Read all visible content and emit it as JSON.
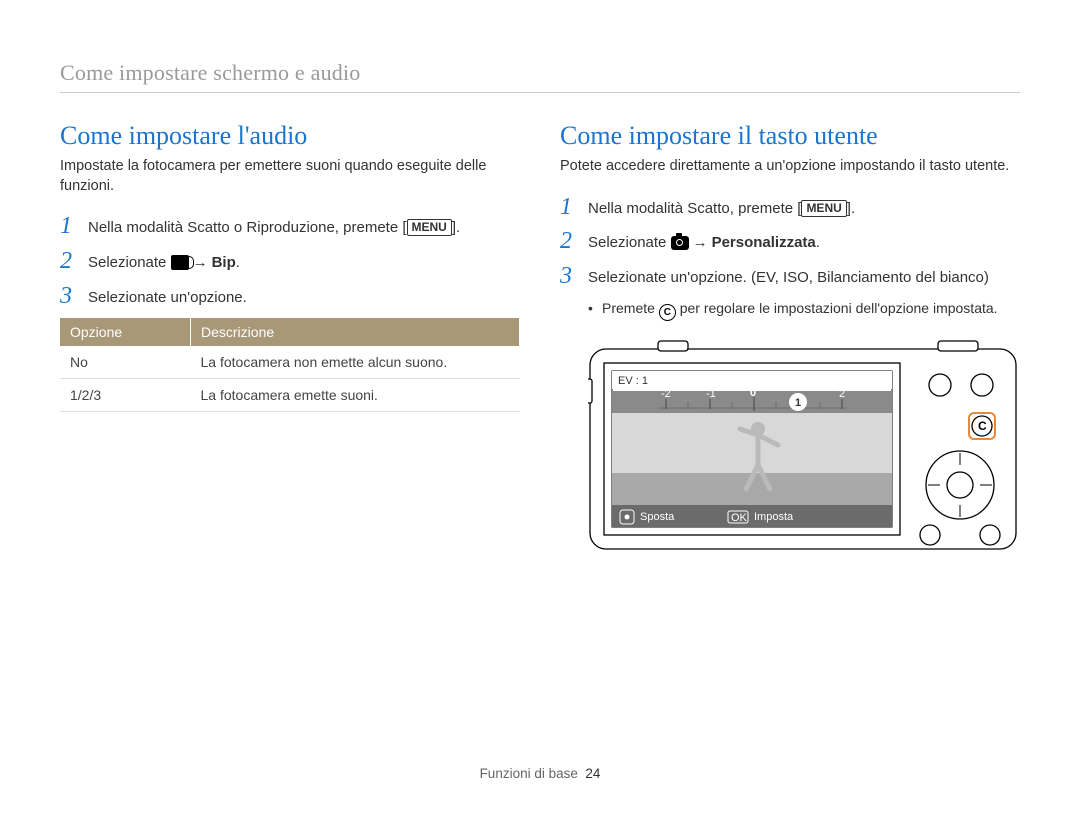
{
  "header": {
    "running_title": "Come impostare schermo e audio"
  },
  "left": {
    "heading": "Come impostare l'audio",
    "intro": "Impostate la fotocamera per emettere suoni quando eseguite delle funzioni.",
    "steps": [
      {
        "n": "1",
        "pre": "Nella modalità Scatto o Riproduzione, premete [",
        "menu": "MENU",
        "post": "]."
      },
      {
        "n": "2",
        "pre": "Selezionate ",
        "icon": "sound",
        "arrow": "→",
        "bold": "Bip",
        "post": "."
      },
      {
        "n": "3",
        "pre": "Selezionate un'opzione."
      }
    ],
    "table": {
      "headers": [
        "Opzione",
        "Descrizione"
      ],
      "rows": [
        [
          "No",
          "La fotocamera non emette alcun suono."
        ],
        [
          "1/2/3",
          "La fotocamera emette suoni."
        ]
      ]
    }
  },
  "right": {
    "heading": "Come impostare il tasto utente",
    "intro": "Potete accedere direttamente a un'opzione impostando il tasto utente.",
    "steps": [
      {
        "n": "1",
        "pre": "Nella modalità Scatto, premete [",
        "menu": "MENU",
        "post": "]."
      },
      {
        "n": "2",
        "pre": "Selezionate ",
        "icon": "camera",
        "arrow": "→",
        "bold": "Personalizzata",
        "post": "."
      },
      {
        "n": "3",
        "pre": "Selezionate un'opzione. (EV, ISO, Bilanciamento del bianco)"
      }
    ],
    "bullet": {
      "pre": "Premete ",
      "btn": "C",
      "post": " per regolare le impostazioni dell'opzione impostata."
    },
    "camera_screen": {
      "ev_label": "EV : 1",
      "scale": {
        "ticks": [
          "-2",
          "-1",
          "0",
          "1",
          "2"
        ],
        "selected_index": 3
      },
      "bottom_left_icon_label": "Sposta",
      "bottom_right_icon_label": "Imposta",
      "ok_label": "OK"
    },
    "c_button": "C"
  },
  "footer": {
    "section": "Funzioni di base",
    "page": "24"
  }
}
